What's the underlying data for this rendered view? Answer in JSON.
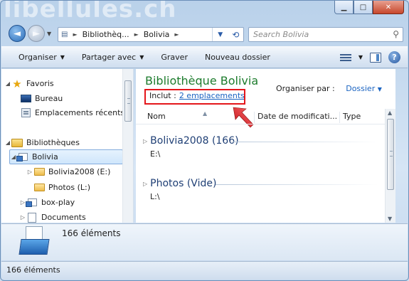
{
  "titlebar": {
    "watermark": "libellules.ch",
    "min": "▁",
    "max": "□",
    "close": "✕"
  },
  "nav": {
    "back": "◄",
    "forward": "►",
    "breadcrumb": [
      "Bibliothèq...",
      "Bolivia"
    ],
    "search_placeholder": "Search Bolivia"
  },
  "toolbar": {
    "organise": "Organiser",
    "share": "Partager avec",
    "burn": "Graver",
    "new_folder": "Nouveau dossier",
    "help": "?"
  },
  "sidebar": {
    "items": [
      {
        "label": "Favoris",
        "icon": "star-icon",
        "level": 0
      },
      {
        "label": "Bureau",
        "icon": "desktop-icon",
        "level": 1
      },
      {
        "label": "Emplacements récents",
        "icon": "recent-places-icon",
        "level": 1
      },
      {
        "label": "Bibliothèques",
        "icon": "libraries-icon",
        "level": 0
      },
      {
        "label": "Bolivia",
        "icon": "library-icon",
        "level": 1,
        "selected": true
      },
      {
        "label": "Bolivia2008 (E:)",
        "icon": "folder-icon",
        "level": 2
      },
      {
        "label": "Photos (L:)",
        "icon": "folder-icon",
        "level": 2
      },
      {
        "label": "box-play",
        "icon": "library-icon",
        "level": 1
      },
      {
        "label": "Documents",
        "icon": "documents-icon",
        "level": 1
      }
    ]
  },
  "library": {
    "title": "Bibliothèque Bolivia",
    "include_label": "Inclut :",
    "include_link": "2 emplacements",
    "arrange_label": "Organiser par :",
    "arrange_value": "Dossier",
    "columns": {
      "name": "Nom",
      "date": "Date de modificati...",
      "type": "Type"
    },
    "groups": [
      {
        "title": "Bolivia2008 (166)",
        "path": "E:\\"
      },
      {
        "title": "Photos (Vide)",
        "path": "L:\\"
      }
    ]
  },
  "details": {
    "count": "166 éléments"
  },
  "status": {
    "text": "166 éléments"
  },
  "colors": {
    "title_green": "#1d7c2d",
    "link_blue": "#1a63c1",
    "highlight_red": "#e4161b"
  }
}
